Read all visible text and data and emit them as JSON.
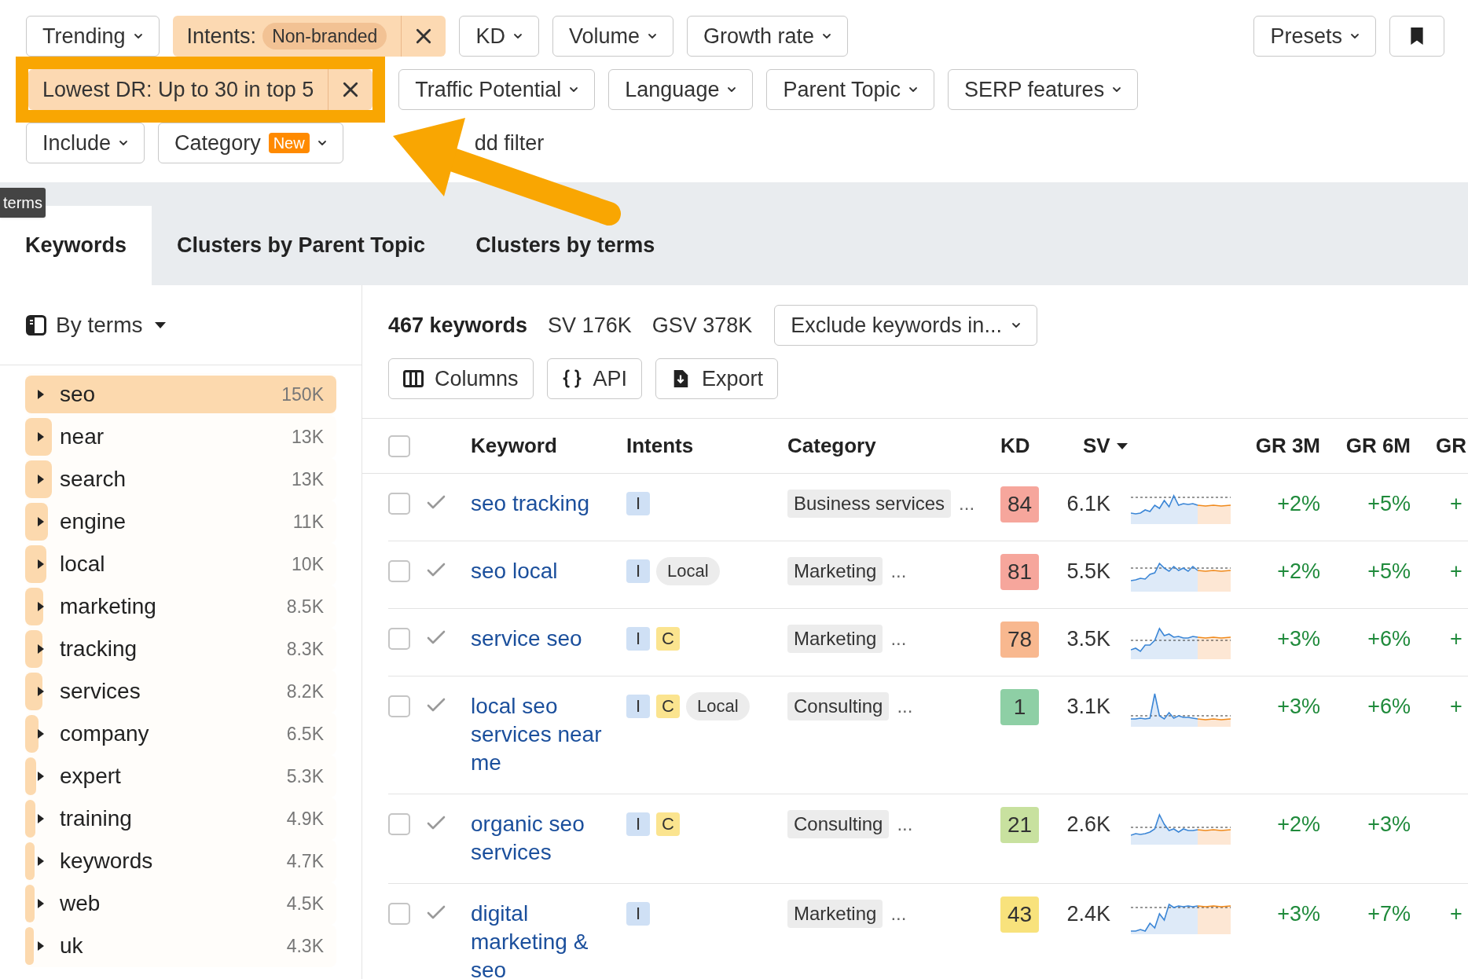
{
  "filter_rows": [
    [
      {
        "kind": "dropdown",
        "label": "Trending",
        "highlighted": false
      },
      {
        "kind": "applied",
        "label": "Intents:",
        "value": "Non-branded",
        "highlighted": false
      },
      {
        "kind": "dropdown",
        "label": "KD",
        "highlighted": false
      },
      {
        "kind": "dropdown",
        "label": "Volume",
        "highlighted": false
      },
      {
        "kind": "dropdown",
        "label": "Growth rate",
        "highlighted": false
      }
    ],
    [
      {
        "kind": "applied",
        "label": "Lowest DR: Up to 30 in top 5",
        "highlighted": true
      },
      {
        "kind": "dropdown",
        "label": "Traffic Potential",
        "highlighted": false
      },
      {
        "kind": "dropdown",
        "label": "Language",
        "highlighted": false
      },
      {
        "kind": "dropdown",
        "label": "Parent Topic",
        "highlighted": false
      },
      {
        "kind": "dropdown",
        "label": "SERP features",
        "highlighted": false
      }
    ],
    [
      {
        "kind": "dropdown",
        "label": "Include",
        "highlighted": false
      },
      {
        "kind": "dropdown",
        "label": "Category",
        "badge": "New",
        "highlighted": false
      },
      {
        "kind": "link",
        "label": "dd filter",
        "highlighted": false
      }
    ]
  ],
  "presets": {
    "label": "Presets"
  },
  "tooltip": {
    "text": "terms"
  },
  "tabs": [
    {
      "label": "Keywords",
      "selected": true
    },
    {
      "label": "Clusters by Parent Topic",
      "selected": false
    },
    {
      "label": "Clusters by terms",
      "selected": false
    }
  ],
  "sidebar": {
    "mode": "By terms",
    "items": [
      {
        "term": "seo",
        "count": "150K",
        "level": 1
      },
      {
        "term": "near",
        "count": "13K",
        "level": 0.087
      },
      {
        "term": "search",
        "count": "13K",
        "level": 0.087
      },
      {
        "term": "engine",
        "count": "11K",
        "level": 0.073
      },
      {
        "term": "local",
        "count": "10K",
        "level": 0.067
      },
      {
        "term": "marketing",
        "count": "8.5K",
        "level": 0.057
      },
      {
        "term": "tracking",
        "count": "8.3K",
        "level": 0.055
      },
      {
        "term": "services",
        "count": "8.2K",
        "level": 0.055
      },
      {
        "term": "company",
        "count": "6.5K",
        "level": 0.043
      },
      {
        "term": "expert",
        "count": "5.3K",
        "level": 0.035
      },
      {
        "term": "training",
        "count": "4.9K",
        "level": 0.033
      },
      {
        "term": "keywords",
        "count": "4.7K",
        "level": 0.031
      },
      {
        "term": "web",
        "count": "4.5K",
        "level": 0.03
      },
      {
        "term": "uk",
        "count": "4.3K",
        "level": 0.029
      }
    ]
  },
  "summary": {
    "count": "467 keywords",
    "sv": "SV 176K",
    "gsv": "GSV 378K",
    "exclude": "Exclude keywords in..."
  },
  "actions": [
    {
      "kind": "columns",
      "label": "Columns"
    },
    {
      "kind": "api",
      "label": "API"
    },
    {
      "kind": "export",
      "label": "Export"
    }
  ],
  "table": {
    "checked": false,
    "columns": [
      {
        "label": "Keyword",
        "sorted": false
      },
      {
        "label": "Intents",
        "sorted": false
      },
      {
        "label": "Category",
        "sorted": false
      },
      {
        "label": "KD",
        "sorted": false
      },
      {
        "label": "SV",
        "sorted": true
      },
      {
        "label": "GR 3M",
        "sorted": false
      },
      {
        "label": "GR 6M",
        "sorted": false
      },
      {
        "label": "GR",
        "sorted": false
      }
    ],
    "rows": [
      {
        "checked": false,
        "keyword": "seo tracking",
        "tags": [
          {
            "kind": "informational",
            "text": "I"
          }
        ],
        "category": "Business services",
        "more": "...",
        "kd": {
          "text": "84",
          "color": "#f6a69c"
        },
        "sv": "6.1K",
        "gr_3m": "+2%",
        "gr_6m": "+5%",
        "gr": "+"
      },
      {
        "checked": false,
        "keyword": "seo local",
        "tags": [
          {
            "kind": "informational",
            "text": "I"
          },
          {
            "kind": "modifier",
            "text": "Local"
          }
        ],
        "category": "Marketing",
        "more": "...",
        "kd": {
          "text": "81",
          "color": "#f6a69c"
        },
        "sv": "5.5K",
        "gr_3m": "+2%",
        "gr_6m": "+5%",
        "gr": "+"
      },
      {
        "checked": false,
        "keyword": "service seo",
        "tags": [
          {
            "kind": "informational",
            "text": "I"
          },
          {
            "kind": "commercial",
            "text": "C"
          }
        ],
        "category": "Marketing",
        "more": "...",
        "kd": {
          "text": "78",
          "color": "#f8b88f"
        },
        "sv": "3.5K",
        "gr_3m": "+3%",
        "gr_6m": "+6%",
        "gr": "+"
      },
      {
        "checked": false,
        "keyword": "local seo services near me",
        "tags": [
          {
            "kind": "informational",
            "text": "I"
          },
          {
            "kind": "commercial",
            "text": "C"
          },
          {
            "kind": "modifier",
            "text": "Local"
          }
        ],
        "category": "Consulting",
        "more": "...",
        "kd": {
          "text": "1",
          "color": "#8ecfa5"
        },
        "sv": "3.1K",
        "gr_3m": "+3%",
        "gr_6m": "+6%",
        "gr": "+"
      },
      {
        "checked": false,
        "keyword": "organic seo services",
        "tags": [
          {
            "kind": "informational",
            "text": "I"
          },
          {
            "kind": "commercial",
            "text": "C"
          }
        ],
        "category": "Consulting",
        "more": "...",
        "kd": {
          "text": "21",
          "color": "#c8e19f"
        },
        "sv": "2.6K",
        "gr_3m": "+2%",
        "gr_6m": "+3%"
      },
      {
        "checked": false,
        "keyword": "digital marketing & seo",
        "tags": [
          {
            "kind": "informational",
            "text": "I"
          }
        ],
        "category": "Marketing",
        "more": "...",
        "kd": {
          "text": "43",
          "color": "#f8e27c"
        },
        "sv": "2.4K",
        "gr_3m": "+3%",
        "gr_6m": "+7%",
        "gr": "+"
      }
    ]
  }
}
